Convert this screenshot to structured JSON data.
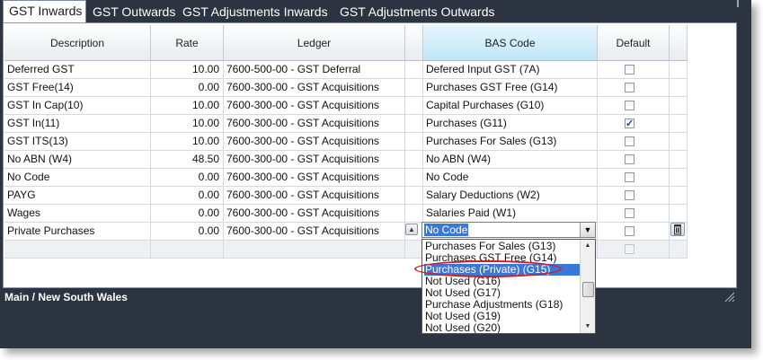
{
  "tabs": [
    {
      "label": "GST Inwards"
    },
    {
      "label": "GST Outwards"
    },
    {
      "label": "GST Adjustments Inwards"
    },
    {
      "label": "GST Adjustments Outwards"
    }
  ],
  "grid": {
    "headers": {
      "description": "Description",
      "rate": "Rate",
      "ledger": "Ledger",
      "bas_code": "BAS Code",
      "default": "Default"
    },
    "rows": [
      {
        "description": "Deferred GST",
        "rate": "10.00",
        "ledger": "7600-500-00 - GST Deferral",
        "bas_code": "Defered Input GST (7A)",
        "default": false
      },
      {
        "description": "GST Free(14)",
        "rate": "0.00",
        "ledger": "7600-300-00 - GST Acquisitions",
        "bas_code": "Purchases GST Free (G14)",
        "default": false
      },
      {
        "description": "GST In Cap(10)",
        "rate": "10.00",
        "ledger": "7600-300-00 - GST Acquisitions",
        "bas_code": "Capital Purchases (G10)",
        "default": false
      },
      {
        "description": "GST In(11)",
        "rate": "10.00",
        "ledger": "7600-300-00 - GST Acquisitions",
        "bas_code": "Purchases (G11)",
        "default": true
      },
      {
        "description": "GST ITS(13)",
        "rate": "10.00",
        "ledger": "7600-300-00 - GST Acquisitions",
        "bas_code": "Purchases For Sales (G13)",
        "default": false
      },
      {
        "description": "No ABN (W4)",
        "rate": "48.50",
        "ledger": "7600-300-00 - GST Acquisitions",
        "bas_code": "No ABN (W4)",
        "default": false
      },
      {
        "description": "No Code",
        "rate": "0.00",
        "ledger": "7600-300-00 - GST Acquisitions",
        "bas_code": "No Code",
        "default": false
      },
      {
        "description": "PAYG",
        "rate": "0.00",
        "ledger": "7600-300-00 - GST Acquisitions",
        "bas_code": "Salary Deductions (W2)",
        "default": false
      },
      {
        "description": "Wages",
        "rate": "0.00",
        "ledger": "7600-300-00 - GST Acquisitions",
        "bas_code": "Salaries Paid (W1)",
        "default": false
      },
      {
        "description": "Private Purchases",
        "rate": "0.00",
        "ledger": "7600-300-00 - GST Acquisitions",
        "bas_code": "",
        "default": false
      }
    ],
    "editing_combo_value": "No Code"
  },
  "dropdown": {
    "options": [
      "Purchases For Sales (G13)",
      "Purchases GST Free (G14)",
      "Purchases (Private) (G15)",
      "Not Used (G16)",
      "Not Used (G17)",
      "Purchase Adjustments (G18)",
      "Not Used (G19)",
      "Not Used (G20)"
    ],
    "selected_index": 2
  },
  "status_bar": {
    "text": "Main / New South Wales"
  },
  "colors": {
    "frame": "#2b3440",
    "selection": "#3a78d8",
    "highlight_ring": "#d11f1f",
    "bas_header": "#bfe6f7"
  }
}
